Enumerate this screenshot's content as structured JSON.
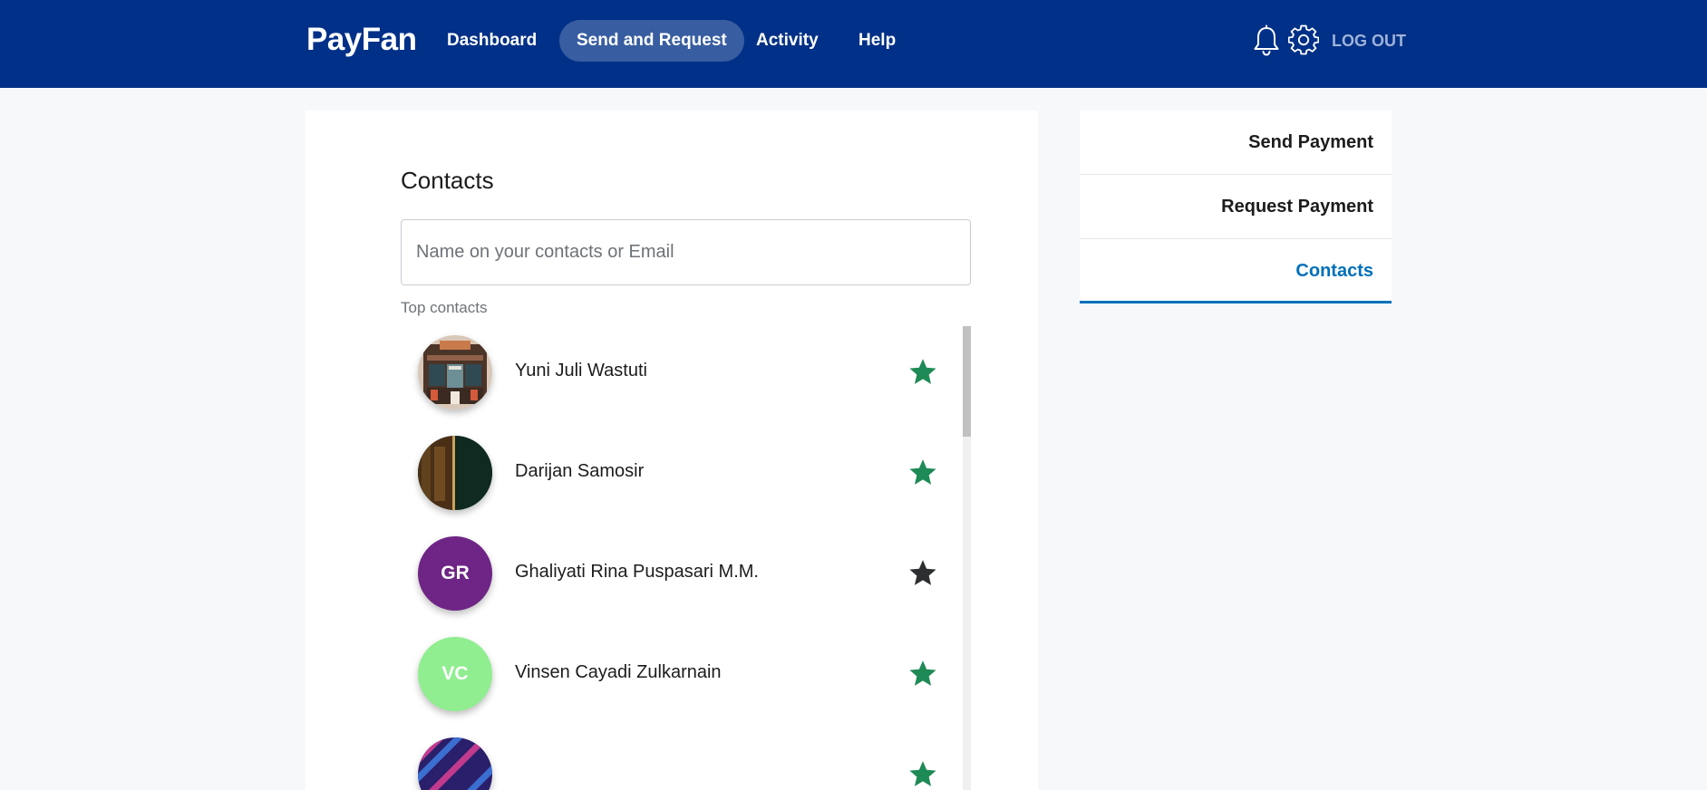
{
  "header": {
    "brand": "PayFan",
    "nav": [
      {
        "label": "Dashboard",
        "active": false
      },
      {
        "label": "Send and Request",
        "active": true
      },
      {
        "label": "Activity",
        "active": false
      },
      {
        "label": "Help",
        "active": false
      }
    ],
    "icons": [
      "bell-icon",
      "gear-icon"
    ],
    "logout_label": "LOG OUT",
    "bg_color": "#003087"
  },
  "main": {
    "title": "Contacts",
    "search": {
      "placeholder": "Name on your contacts or Email",
      "value": ""
    },
    "top_contacts_label": "Top contacts",
    "contacts": [
      {
        "name": "Yuni Juli Wastuti",
        "initials": "",
        "avatar": "photo-storefront",
        "favorite": true
      },
      {
        "name": "Darijan Samosir",
        "initials": "",
        "avatar": "photo-forest-split",
        "favorite": true
      },
      {
        "name": "Ghaliyati Rina Puspasari M.M.",
        "initials": "GR",
        "avatar_color": "#6e2585",
        "favorite": false
      },
      {
        "name": "Vinsen Cayadi Zulkarnain",
        "initials": "VC",
        "avatar_color": "#90ee90",
        "favorite": true
      },
      {
        "name": "",
        "initials": "",
        "avatar": "photo-abstract-pattern",
        "favorite": true
      }
    ],
    "colors": {
      "star_favorite": "#1e8a55",
      "star_plain": "#2c2e2f"
    }
  },
  "side_menu": {
    "items": [
      {
        "label": "Send Payment",
        "active": false
      },
      {
        "label": "Request Payment",
        "active": false
      },
      {
        "label": "Contacts",
        "active": true
      }
    ],
    "accent": "#0070ba"
  }
}
